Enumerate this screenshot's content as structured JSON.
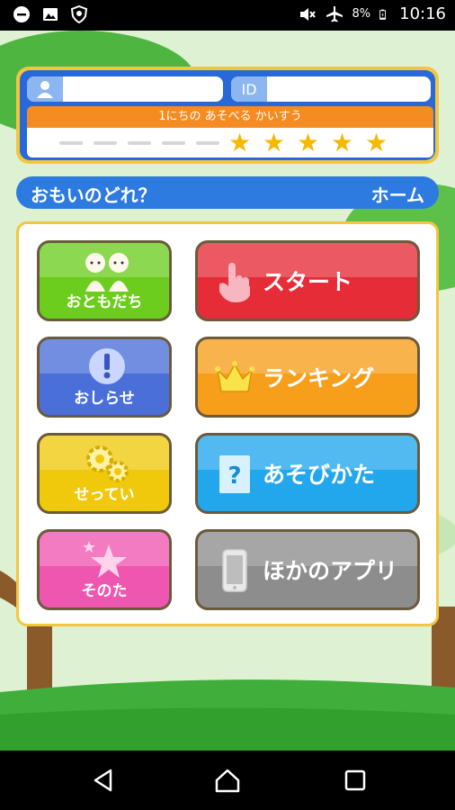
{
  "status_bar": {
    "battery_percent": "8%",
    "time": "10:16",
    "icons": [
      "minus-circle-icon",
      "image-icon",
      "shield-icon",
      "mute-icon",
      "airplane-icon",
      "battery-charging-icon"
    ]
  },
  "profile": {
    "name_value": "",
    "id_label": "ID",
    "id_value": "",
    "play_count_label": "1にちの あそべる かいすう",
    "plays_used": 5,
    "plays_total": 10
  },
  "title_bar": {
    "prompt": "おもいのどれ？",
    "home_label": "ホーム"
  },
  "menu": {
    "friends": "おともだち",
    "news": "おしらせ",
    "settings": "せってい",
    "other": "そのた",
    "start": "スタート",
    "ranking": "ランキング",
    "howto": "あそびかた",
    "other_apps": "ほかのアプリ"
  },
  "colors": {
    "brand_blue": "#2769d8",
    "accent_yellow": "#f3c640",
    "star": "#f6b800"
  }
}
